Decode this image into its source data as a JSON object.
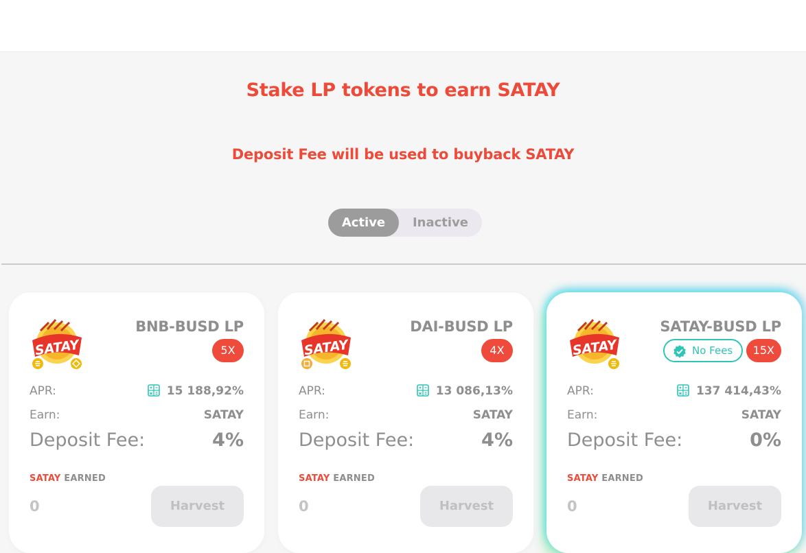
{
  "header": {
    "title": "Stake LP tokens to earn SATAY",
    "subtitle": "Deposit Fee will be used to buyback SATAY"
  },
  "toggle": {
    "active_label": "Active",
    "inactive_label": "Inactive",
    "selected": "Active"
  },
  "colors": {
    "accent": "#ec4b3a",
    "multiplier_badge": "#ef4b3c",
    "no_fees": "#2ec4b6",
    "muted_text": "#8e8e8e",
    "toggle_active": "#9c9c9c"
  },
  "farms": [
    {
      "pair": "BNB-BUSD LP",
      "multiplier": "5X",
      "no_fees": "",
      "logo_text": "SATAY",
      "apr_label": "APR:",
      "apr": "15 188,92%",
      "earn_label": "Earn:",
      "earn": "SATAY",
      "fee_label": "Deposit Fee:",
      "fee": "4%",
      "earned_token": "SATAY",
      "earned_label": "EARNED",
      "earned_amount": "0",
      "harvest_label": "Harvest"
    },
    {
      "pair": "DAI-BUSD LP",
      "multiplier": "4X",
      "no_fees": "",
      "logo_text": "SATAY",
      "apr_label": "APR:",
      "apr": "13 086,13%",
      "earn_label": "Earn:",
      "earn": "SATAY",
      "fee_label": "Deposit Fee:",
      "fee": "4%",
      "earned_token": "SATAY",
      "earned_label": "EARNED",
      "earned_amount": "0",
      "harvest_label": "Harvest"
    },
    {
      "pair": "SATAY-BUSD LP",
      "multiplier": "15X",
      "no_fees": "No Fees",
      "logo_text": "SATAY",
      "apr_label": "APR:",
      "apr": "137 414,43%",
      "earn_label": "Earn:",
      "earn": "SATAY",
      "fee_label": "Deposit Fee:",
      "fee": "0%",
      "earned_token": "SATAY",
      "earned_label": "EARNED",
      "earned_amount": "0",
      "harvest_label": "Harvest"
    }
  ]
}
